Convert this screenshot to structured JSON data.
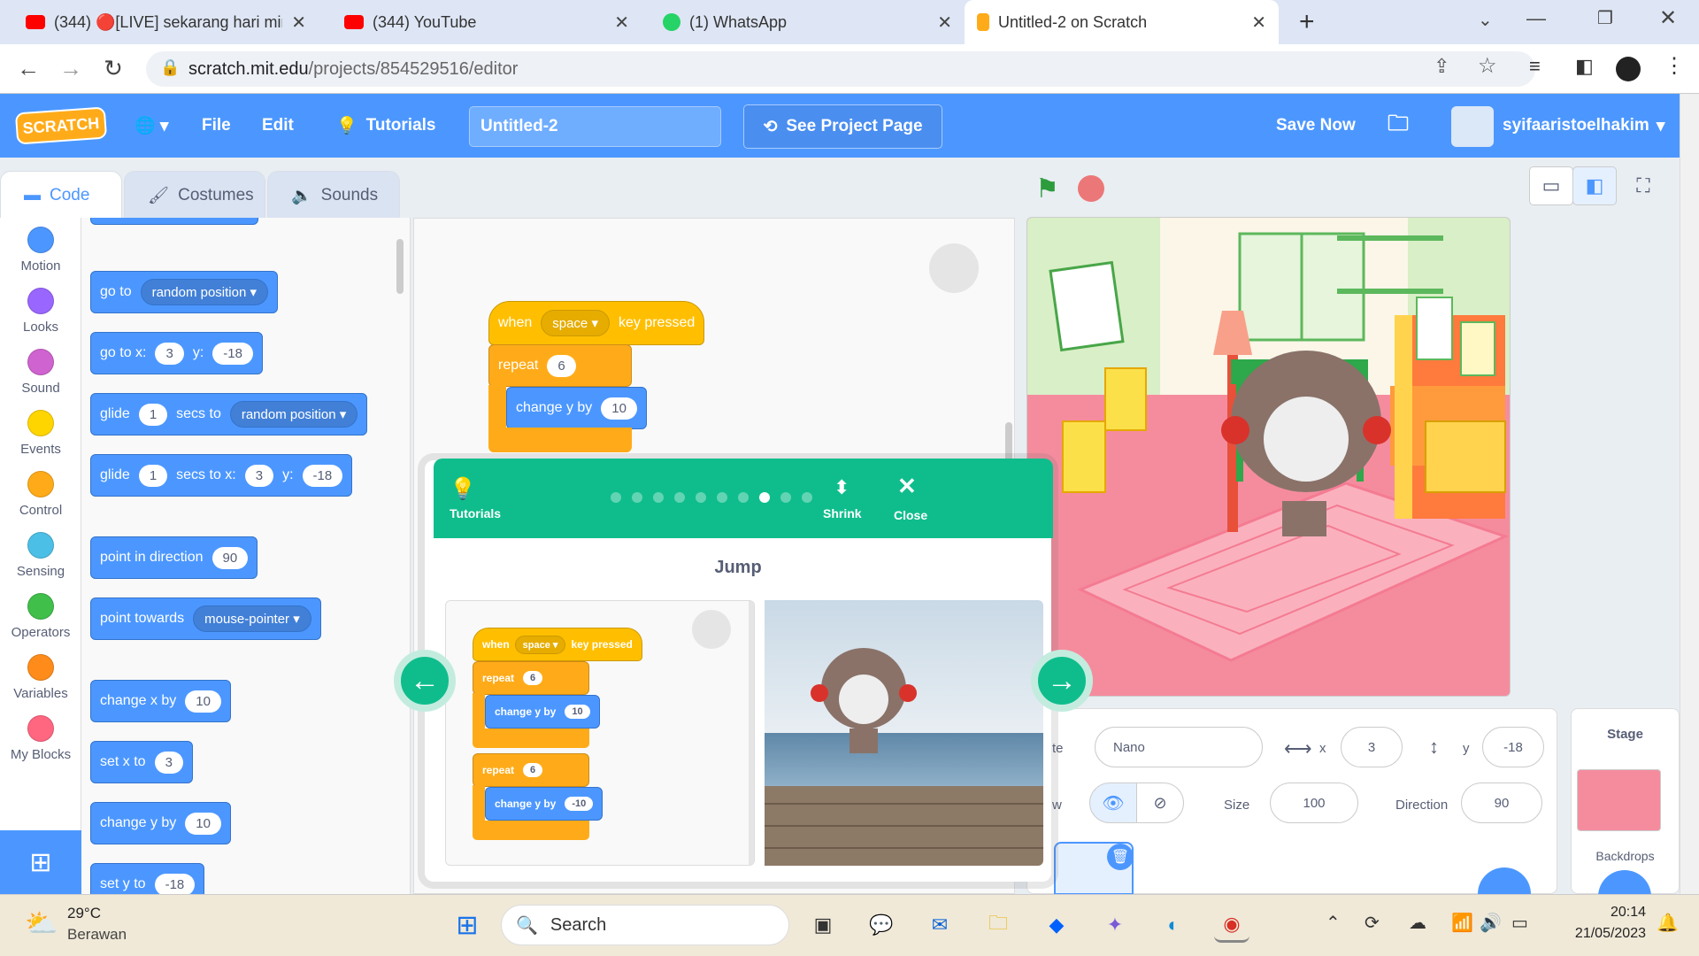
{
  "browser": {
    "tabs": [
      {
        "label": "(344) 🔴[LIVE] sekarang hari min",
        "color": "#ff0000"
      },
      {
        "label": "(344) YouTube",
        "color": "#ff0000"
      },
      {
        "label": "(1) WhatsApp",
        "color": "#25d366"
      },
      {
        "label": "Untitled-2 on Scratch",
        "color": "#ffab19"
      }
    ],
    "url_host": "scratch.mit.edu",
    "url_path": "/projects/854529516/editor"
  },
  "menu": {
    "logo": "SCRATCH",
    "file": "File",
    "edit": "Edit",
    "tutorials": "Tutorials",
    "project_title": "Untitled-2",
    "see_project": "See Project Page",
    "save_now": "Save Now",
    "username": "syifaaristoelhakim"
  },
  "editor_tabs": {
    "code": "Code",
    "costumes": "Costumes",
    "sounds": "Sounds"
  },
  "categories": [
    {
      "label": "Motion",
      "color": "#4c97ff"
    },
    {
      "label": "Looks",
      "color": "#9966ff"
    },
    {
      "label": "Sound",
      "color": "#cf63cf"
    },
    {
      "label": "Events",
      "color": "#ffd500"
    },
    {
      "label": "Control",
      "color": "#ffab19"
    },
    {
      "label": "Sensing",
      "color": "#4cbfe6"
    },
    {
      "label": "Operators",
      "color": "#40bf4a"
    },
    {
      "label": "Variables",
      "color": "#ff8c1a"
    },
    {
      "label": "My Blocks",
      "color": "#ff6680"
    }
  ],
  "palette": {
    "goto_label": "go to",
    "goto_drop": "random position",
    "gotoxy_label": "go to x:",
    "gotoxy_x": "3",
    "gotoxy_ylabel": "y:",
    "gotoxy_y": "-18",
    "glide1_label": "glide",
    "glide1_n": "1",
    "glide1_mid": "secs to",
    "glide1_drop": "random position",
    "glide2_label": "glide",
    "glide2_n": "1",
    "glide2_mid": "secs to x:",
    "glide2_x": "3",
    "glide2_ylabel": "y:",
    "glide2_y": "-18",
    "point_dir_label": "point in direction",
    "point_dir_val": "90",
    "point_towards_label": "point towards",
    "point_towards_drop": "mouse-pointer",
    "changex_label": "change x by",
    "changex_val": "10",
    "setx_label": "set x to",
    "setx_val": "3",
    "changey_label": "change y by",
    "changey_val": "10",
    "sety_label": "set y to",
    "sety_val": "-18"
  },
  "script": {
    "when": "when",
    "key": "space",
    "key_pressed": "key pressed",
    "repeat": "repeat",
    "repeat_n": "6",
    "change_y": "change y by",
    "change_y_val": "10"
  },
  "tutorial": {
    "tutorials_label": "Tutorials",
    "shrink": "Shrink",
    "close": "Close",
    "title": "Jump",
    "steps_total": 10,
    "step_current": 8,
    "mini": {
      "when": "when",
      "key": "space",
      "key_pressed": "key pressed",
      "repeat1": "repeat",
      "repeat1_n": "6",
      "change1": "change y by",
      "change1_val": "10",
      "repeat2": "repeat",
      "repeat2_n": "6",
      "change2": "change y by",
      "change2_val": "-10"
    }
  },
  "sprite_info": {
    "sprite_label": "te",
    "sprite_name": "Nano",
    "x_label": "x",
    "x_val": "3",
    "y_label": "y",
    "y_val": "-18",
    "show_label": "w",
    "size_label": "Size",
    "size_val": "100",
    "direction_label": "Direction",
    "direction_val": "90"
  },
  "stage_panel": {
    "title": "Stage",
    "backdrops": "Backdrops"
  },
  "taskbar": {
    "temp": "29°C",
    "weather": "Berawan",
    "search": "Search",
    "time": "20:14",
    "date": "21/05/2023"
  }
}
